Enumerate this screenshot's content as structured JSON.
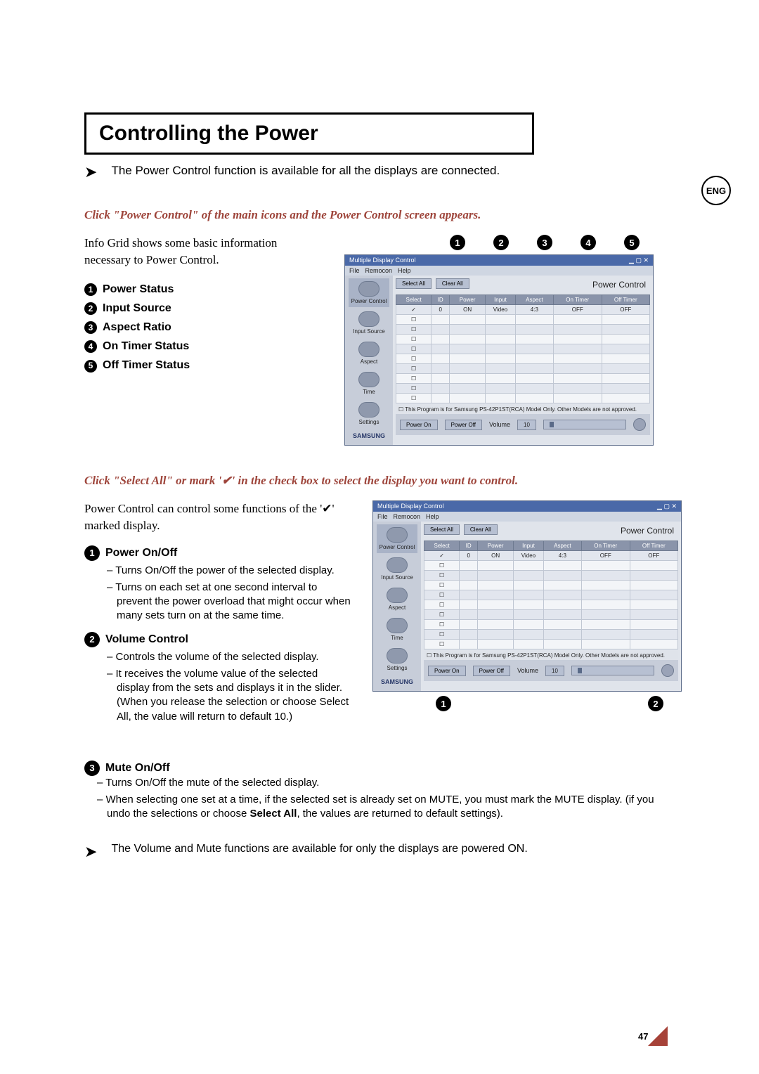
{
  "lang_badge": "ENG",
  "title": "Controlling the Power",
  "intro": "The Power Control function is available for all the displays are connected.",
  "red1": "Click \"Power Control\" of the main icons and the Power Control screen appears.",
  "grid_desc": "Info Grid shows some basic information necessary to Power Control.",
  "status_items": {
    "s1": "Power Status",
    "s2": "Input Source",
    "s3": "Aspect Ratio",
    "s4": "On Timer Status",
    "s5": "Off Timer Status"
  },
  "callouts_top": {
    "c1": "1",
    "c2": "2",
    "c3": "3",
    "c4": "4",
    "c5": "5"
  },
  "app": {
    "title": "Multiple Display Control",
    "menu": {
      "file": "File",
      "remocon": "Remocon",
      "help": "Help"
    },
    "sidebar": {
      "power": "Power Control",
      "input": "Input Source",
      "aspect": "Aspect",
      "time": "Time",
      "settings": "Settings"
    },
    "panel_title": "Power Control",
    "select_all": "Select All",
    "clear_all": "Clear All",
    "headers": {
      "select": "Select",
      "id": "ID",
      "power": "Power",
      "input": "Input",
      "aspect": "Aspect",
      "on_timer": "On Timer",
      "off_timer": "Off Timer"
    },
    "row0": {
      "id": "0",
      "power": "ON",
      "input": "Video",
      "aspect": "4:3",
      "on": "OFF",
      "off": "OFF"
    },
    "hint": "This Program is for Samsung PS-42P1ST(RCA) Model Only. Other Models are not approved.",
    "btn_power_on": "Power On",
    "btn_power_off": "Power Off",
    "vol_label": "Volume",
    "vol_value": "10",
    "logo": "SAMSUNG"
  },
  "red2": "Click \"Select All\" or mark '✔' in the check box to select the display you want to control.",
  "desc2": "Power Control can control some functions of the '✔' marked display.",
  "detail": {
    "p1": "Power On/Off",
    "p1a": "Turns On/Off the power of the selected display.",
    "p1b": "Turns on each set at one second interval to prevent the power overload that might occur when many sets turn on at the same time.",
    "p2": "Volume Control",
    "p2a": "Controls the volume of the selected display.",
    "p2b": "It receives the volume value of the selected display from the sets and displays it in the slider. (When you release the selection or choose Select All, the value will return to default 10.)",
    "p3": "Mute On/Off",
    "p3a": "Turns On/Off the mute of the selected display.",
    "p3b_1": "When selecting one set at a time, if the selected set is already set on MUTE, you must mark the MUTE display. (if you undo the selections or choose ",
    "p3b_bold": "Select All",
    "p3b_2": ", the values are returned to default settings)."
  },
  "callouts_bottom": {
    "c1": "1",
    "c2": "2",
    "c3": "3"
  },
  "footer_note": "The Volume and Mute functions are available for only the displays are powered ON.",
  "page_num": "47",
  "chart_data": {
    "type": "table",
    "title": "Power Control grid sample row",
    "headers": [
      "Select",
      "ID",
      "Power",
      "Input",
      "Aspect",
      "On Timer",
      "Off Timer"
    ],
    "rows": [
      [
        "✓",
        "0",
        "ON",
        "Video",
        "4:3",
        "OFF",
        "OFF"
      ]
    ]
  }
}
